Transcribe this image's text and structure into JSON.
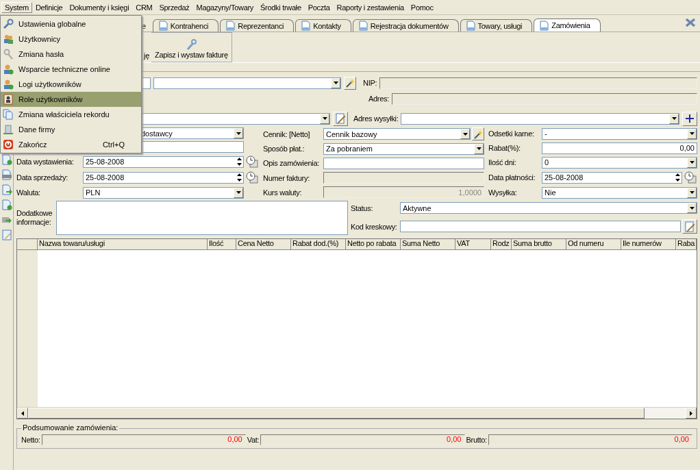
{
  "menubar": [
    {
      "label": "System",
      "selected": true
    },
    {
      "label": "Definicje",
      "selected": false
    },
    {
      "label": "Dokumenty i księgi",
      "selected": false
    },
    {
      "label": "CRM",
      "selected": false
    },
    {
      "label": "Sprzedaż",
      "selected": false
    },
    {
      "label": "Magazyny/Towary",
      "selected": false
    },
    {
      "label": "Środki trwałe",
      "selected": false
    },
    {
      "label": "Poczta",
      "selected": false
    },
    {
      "label": "Raporty i zestawienia",
      "selected": false
    },
    {
      "label": "Pomoc",
      "selected": false
    }
  ],
  "system_menu": [
    {
      "label": "Ustawienia globalne",
      "selected": false
    },
    {
      "label": "Użytkownicy",
      "selected": false
    },
    {
      "label": "Zmiana hasła",
      "selected": false
    },
    {
      "label": "Wsparcie techniczne online",
      "selected": false
    },
    {
      "label": "Logi użytkowników",
      "selected": false
    },
    {
      "label": "Role użytkowników",
      "selected": true
    },
    {
      "label": "Zmiana właściciela rekordu",
      "selected": false
    },
    {
      "label": "Dane firmy",
      "selected": false
    },
    {
      "label": "Zakończ",
      "shortcut": "Ctrl+Q",
      "selected": false
    }
  ],
  "tabs": [
    {
      "label": "e",
      "selected": false
    },
    {
      "label": "Kontrahenci",
      "selected": false
    },
    {
      "label": "Reprezentanci",
      "selected": false
    },
    {
      "label": "Kontakty",
      "selected": false
    },
    {
      "label": "Rejestracja dokumentów",
      "selected": false
    },
    {
      "label": "Towary, usługi",
      "selected": false
    },
    {
      "label": "Zamówienia",
      "selected": true
    }
  ],
  "toolbar": [
    {
      "label": "ję"
    },
    {
      "label": "Zapisz i wystaw fakturę"
    }
  ],
  "customer": {
    "nip_label": "NIP:",
    "address_label": "Adres:",
    "shipping_label": "Adres wysyłki:"
  },
  "form_columns": [
    [
      {
        "value": "dostawcy",
        "kind": "combo"
      },
      {
        "kind": "text"
      },
      {
        "label": "Data wystawienia:",
        "value": "25-08-2008",
        "kind": "date"
      },
      {
        "label": "Data sprzedaży:",
        "value": "25-08-2008",
        "kind": "date"
      },
      {
        "label": "Waluta:",
        "value": "PLN",
        "kind": "combo"
      }
    ],
    [
      {
        "label": "Cennik: [Netto]",
        "value": "Cennik bazowy",
        "kind": "combo-wand"
      },
      {
        "label": "Sposób płat.:",
        "value": "Za pobraniem",
        "kind": "combo"
      },
      {
        "label": "Opis zamówienia:",
        "kind": "text"
      },
      {
        "label": "Numer faktury:",
        "kind": "readonly"
      },
      {
        "label": "Kurs waluty:",
        "value": "1,0000",
        "kind": "readonly"
      }
    ],
    [
      {
        "label": "Odsetki karne:",
        "value": "-",
        "kind": "combo"
      },
      {
        "label": "Rabat(%):",
        "value": "0,00",
        "kind": "number"
      },
      {
        "label": "Ilość dni:",
        "value": "0",
        "kind": "combo"
      },
      {
        "label": "Data płatności:",
        "value": "25-08-2008",
        "kind": "date"
      },
      {
        "label": "Wysyłka:",
        "value": "Nie",
        "kind": "combo"
      }
    ]
  ],
  "notes_label": "Dodatkowe informacje:",
  "status": {
    "label": "Status:",
    "value": "Aktywne"
  },
  "barcode": {
    "label": "Kod kreskowy:"
  },
  "table": {
    "columns": [
      "Nazwa towaru/usługi",
      "Ilość",
      "Cena Netto",
      "Rabat dod.(%)",
      "Netto po rabata",
      "Suma Netto",
      "VAT",
      "Rodz",
      "Suma brutto",
      "Od numeru",
      "Ile numerów",
      "Raba"
    ]
  },
  "summary": {
    "title": "Podsumowanie zamówienia:",
    "items": [
      {
        "label": "Netto:",
        "value": "0,00"
      },
      {
        "label": "Vat:",
        "value": "0,00"
      },
      {
        "label": "Brutto:",
        "value": "0,00"
      }
    ]
  }
}
